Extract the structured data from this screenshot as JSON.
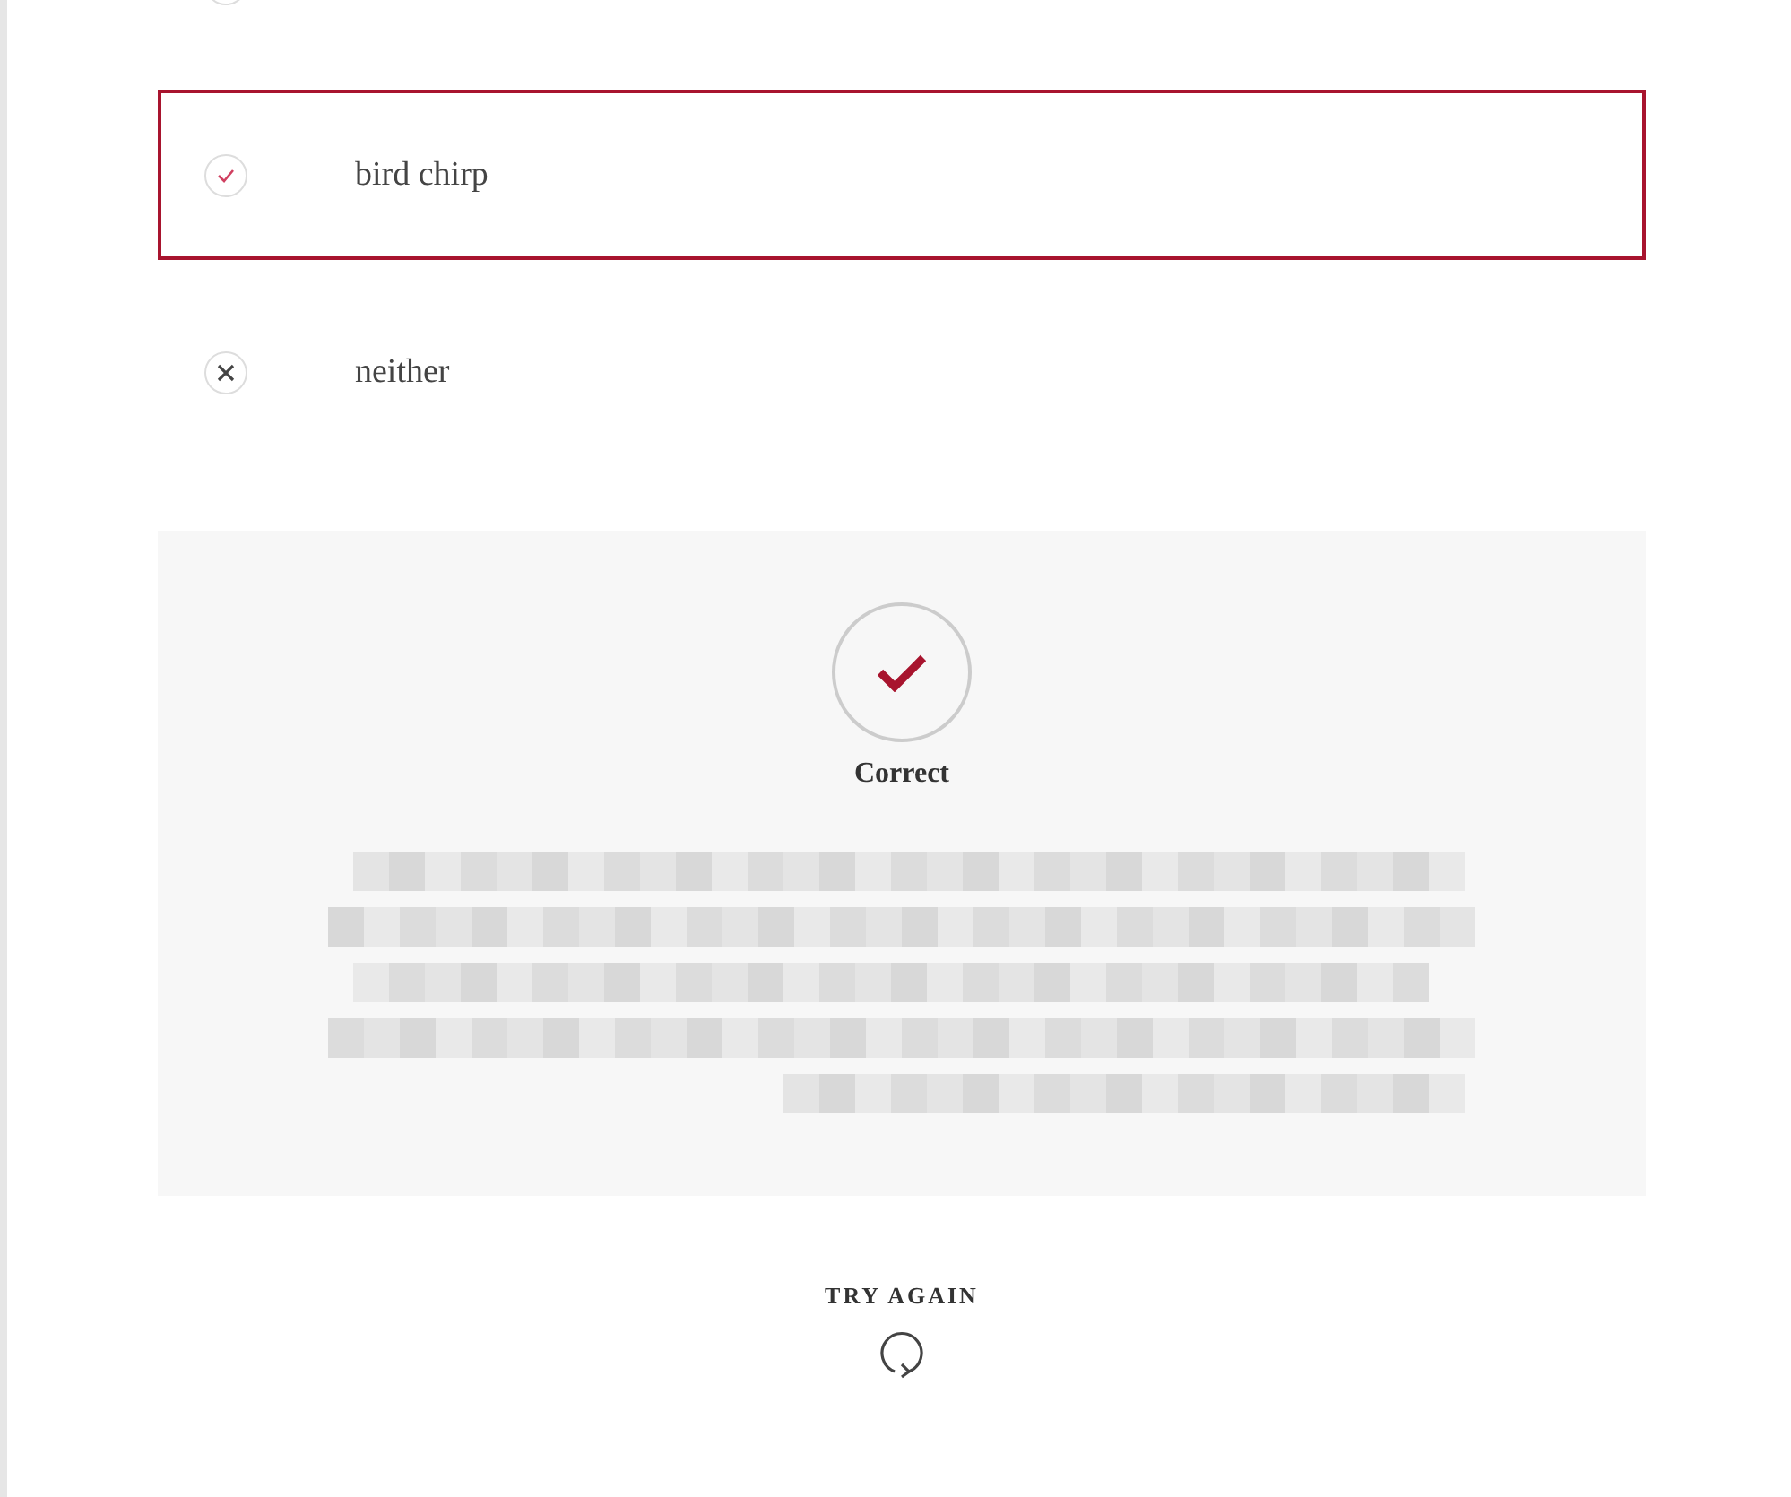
{
  "options": [
    {
      "kind": "blank",
      "selected": false
    },
    {
      "label": "bird chirp",
      "kind": "check",
      "selected": true
    },
    {
      "label": "neither",
      "kind": "cross",
      "selected": false
    }
  ],
  "feedback": {
    "kind": "correct",
    "title": "Correct"
  },
  "try_again": {
    "label": "TRY AGAIN"
  }
}
